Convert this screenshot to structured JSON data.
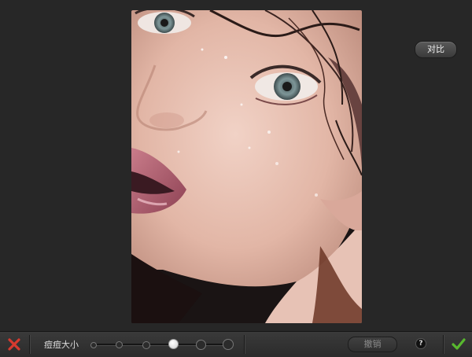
{
  "toolbar": {
    "size_label": "痘痘大小",
    "undo_label": "撤销",
    "help_label": "?",
    "cancel_icon": "close-icon",
    "confirm_icon": "check-icon",
    "slider": {
      "stops": 6,
      "selected_index": 3
    }
  },
  "canvas": {
    "compare_label": "对比"
  },
  "colors": {
    "cancel": "#d63a2f",
    "confirm": "#58b82e",
    "background": "#272727"
  }
}
